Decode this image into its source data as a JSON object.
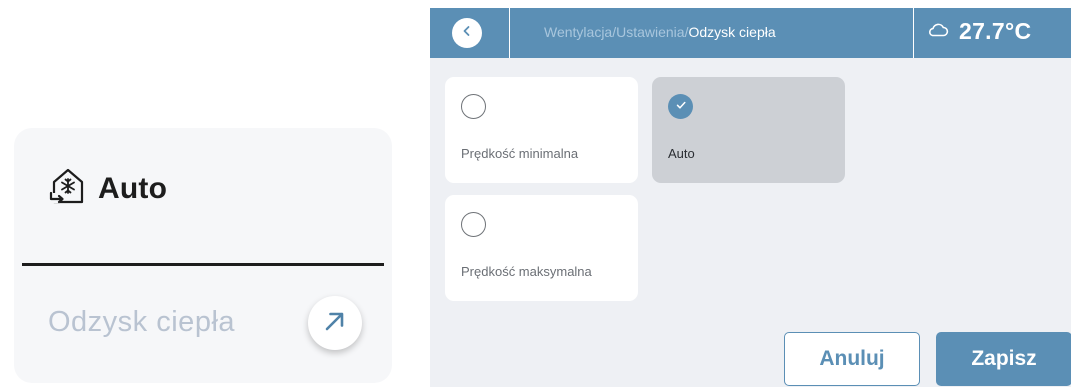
{
  "widget": {
    "title": "Auto",
    "subtitle": "Odzysk ciepła",
    "mode_icon": "house-snowflake-icon",
    "open_icon": "arrow-up-right-icon"
  },
  "screen": {
    "breadcrumb": {
      "parents": "Wentylacja/Ustawienia/",
      "current": "Odzysk ciepła"
    },
    "weather": {
      "icon": "cloud-icon",
      "temperature": "27.7°C"
    },
    "options": [
      {
        "label": "Prędkość minimalna",
        "selected": false
      },
      {
        "label": "Auto",
        "selected": true
      },
      {
        "label": "Prędkość maksymalna",
        "selected": false
      }
    ],
    "cancel_label": "Anuluj",
    "save_label": "Zapisz"
  },
  "colors": {
    "accent": "#5b8fb5",
    "screen_bg": "#eef0f4",
    "selected_option": "#cdd0d5",
    "card_bg": "#f6f7f9",
    "subtitle_text": "#b9c3d1"
  }
}
